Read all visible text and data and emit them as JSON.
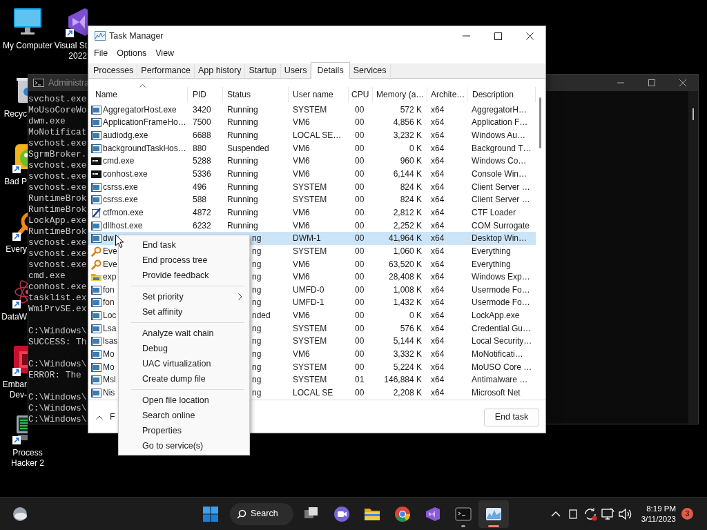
{
  "desktop": {
    "icons": [
      {
        "kind": "monitor",
        "shortcut": false,
        "lines": [
          "My Computer"
        ]
      },
      {
        "kind": "vs",
        "shortcut": true,
        "lines": [
          "Visual St",
          "2022"
        ]
      },
      {
        "kind": "bin",
        "shortcut": false,
        "lines": [
          "Recyc"
        ]
      },
      {
        "kind": "bird",
        "shortcut": true,
        "lines": [
          "Bad P"
        ]
      },
      {
        "kind": "magnifier",
        "shortcut": true,
        "lines": [
          "Every"
        ]
      },
      {
        "kind": "orbit",
        "shortcut": true,
        "lines": [
          "DataW"
        ]
      },
      {
        "kind": "embarcadero",
        "shortcut": true,
        "lines": [
          "Embar",
          "Dev-"
        ]
      },
      {
        "kind": "hacker",
        "shortcut": true,
        "lines": [
          "Process",
          "Hacker 2"
        ]
      }
    ]
  },
  "console": {
    "title": "Administra",
    "blocks": [
      [
        "svchost.exe",
        "MoUsoCoreWo",
        "dwm.exe",
        "MoNotificat",
        "svchost.exe",
        "SgrmBroker.",
        "svchost.exe",
        "svchost.exe",
        "svchost.exe",
        "RuntimeBrok",
        "RuntimeBrok",
        "LockApp.exe",
        "RuntimeBrok",
        "svchost.exe",
        "svchost.exe",
        "svchost.exe",
        "cmd.exe",
        "conhost.exe",
        "tasklist.ex",
        "WmiPrvSE.ex"
      ],
      [
        "C:\\Windows\\",
        "SUCCESS: Th"
      ],
      [
        "C:\\Windows\\",
        "ERROR: The"
      ],
      [
        "C:\\Windows\\",
        "C:\\Windows\\",
        "C:\\Windows\\"
      ]
    ]
  },
  "task_manager": {
    "title": "Task Manager",
    "menu": [
      "File",
      "Options",
      "View"
    ],
    "tabs": [
      {
        "label": "Processes",
        "selected": false
      },
      {
        "label": "Performance",
        "selected": false
      },
      {
        "label": "App history",
        "selected": false
      },
      {
        "label": "Startup",
        "selected": false
      },
      {
        "label": "Users",
        "selected": false
      },
      {
        "label": "Details",
        "selected": true
      },
      {
        "label": "Services",
        "selected": false
      }
    ],
    "columns": [
      {
        "label": "Name",
        "sorted": true
      },
      {
        "label": "PID",
        "sorted": false
      },
      {
        "label": "Status",
        "sorted": false
      },
      {
        "label": "User name",
        "sorted": false
      },
      {
        "label": "CPU",
        "sorted": false
      },
      {
        "label": "Memory (a…",
        "sorted": false
      },
      {
        "label": "Archite…",
        "sorted": false
      },
      {
        "label": "Description",
        "sorted": false
      }
    ],
    "rows": [
      {
        "kind": "app",
        "name": "AggregatorHost.exe",
        "pid": "3420",
        "status": "Running",
        "user": "SYSTEM",
        "cpu": "00",
        "memory": "572 K",
        "arch": "x64",
        "description": "AggregatorH…",
        "selected": false
      },
      {
        "kind": "app",
        "name": "ApplicationFrameHo…",
        "pid": "7500",
        "status": "Running",
        "user": "VM6",
        "cpu": "00",
        "memory": "4,856 K",
        "arch": "x64",
        "description": "Application F…",
        "selected": false
      },
      {
        "kind": "app",
        "name": "audiodg.exe",
        "pid": "6688",
        "status": "Running",
        "user": "LOCAL SE…",
        "cpu": "00",
        "memory": "3,232 K",
        "arch": "x64",
        "description": "Windows Au…",
        "selected": false
      },
      {
        "kind": "app",
        "name": "backgroundTaskHos…",
        "pid": "880",
        "status": "Suspended",
        "user": "VM6",
        "cpu": "00",
        "memory": "0 K",
        "arch": "x64",
        "description": "Background T…",
        "selected": false
      },
      {
        "kind": "console",
        "name": "cmd.exe",
        "pid": "5288",
        "status": "Running",
        "user": "VM6",
        "cpu": "00",
        "memory": "960 K",
        "arch": "x64",
        "description": "Windows Co…",
        "selected": false
      },
      {
        "kind": "console",
        "name": "conhost.exe",
        "pid": "5336",
        "status": "Running",
        "user": "VM6",
        "cpu": "00",
        "memory": "6,144 K",
        "arch": "x64",
        "description": "Console Win…",
        "selected": false
      },
      {
        "kind": "app",
        "name": "csrss.exe",
        "pid": "496",
        "status": "Running",
        "user": "SYSTEM",
        "cpu": "00",
        "memory": "824 K",
        "arch": "x64",
        "description": "Client Server …",
        "selected": false
      },
      {
        "kind": "app",
        "name": "csrss.exe",
        "pid": "588",
        "status": "Running",
        "user": "SYSTEM",
        "cpu": "00",
        "memory": "824 K",
        "arch": "x64",
        "description": "Client Server …",
        "selected": false
      },
      {
        "kind": "pen",
        "name": "ctfmon.exe",
        "pid": "4872",
        "status": "Running",
        "user": "VM6",
        "cpu": "00",
        "memory": "2,812 K",
        "arch": "x64",
        "description": "CTF Loader",
        "selected": false
      },
      {
        "kind": "app",
        "name": "dllhost.exe",
        "pid": "6232",
        "status": "Running",
        "user": "VM6",
        "cpu": "00",
        "memory": "2,252 K",
        "arch": "x64",
        "description": "COM Surrogate",
        "selected": false
      },
      {
        "kind": "app",
        "name": "dw",
        "status": "ng",
        "user": "DWM-1",
        "cpu": "00",
        "memory": "41,964 K",
        "arch": "x64",
        "description": "Desktop Win…",
        "selected": true
      },
      {
        "kind": "search",
        "name": "Eve",
        "status": "ng",
        "user": "SYSTEM",
        "cpu": "00",
        "memory": "1,060 K",
        "arch": "x64",
        "description": "Everything",
        "selected": false
      },
      {
        "kind": "search",
        "name": "Eve",
        "status": "ng",
        "user": "VM6",
        "cpu": "00",
        "memory": "63,520 K",
        "arch": "x64",
        "description": "Everything",
        "selected": false
      },
      {
        "kind": "folder",
        "name": "exp",
        "status": "ng",
        "user": "VM6",
        "cpu": "00",
        "memory": "28,408 K",
        "arch": "x64",
        "description": "Windows Exp…",
        "selected": false
      },
      {
        "kind": "app",
        "name": "fon",
        "status": "ng",
        "user": "UMFD-0",
        "cpu": "00",
        "memory": "1,008 K",
        "arch": "x64",
        "description": "Usermode Fo…",
        "selected": false
      },
      {
        "kind": "app",
        "name": "fon",
        "status": "ng",
        "user": "UMFD-1",
        "cpu": "00",
        "memory": "1,432 K",
        "arch": "x64",
        "description": "Usermode Fo…",
        "selected": false
      },
      {
        "kind": "app",
        "name": "Loc",
        "status": "nded",
        "user": "VM6",
        "cpu": "00",
        "memory": "0 K",
        "arch": "x64",
        "description": "LockApp.exe",
        "selected": false
      },
      {
        "kind": "app",
        "name": "Lsa",
        "status": "ng",
        "user": "SYSTEM",
        "cpu": "00",
        "memory": "576 K",
        "arch": "x64",
        "description": "Credential Gu…",
        "selected": false
      },
      {
        "kind": "app",
        "name": "lsas",
        "status": "ng",
        "user": "SYSTEM",
        "cpu": "00",
        "memory": "5,144 K",
        "arch": "x64",
        "description": "Local Security…",
        "selected": false
      },
      {
        "kind": "app",
        "name": "Mo",
        "status": "ng",
        "user": "VM6",
        "cpu": "00",
        "memory": "3,332 K",
        "arch": "x64",
        "description": "MoNotificati…",
        "selected": false
      },
      {
        "kind": "app",
        "name": "Mo",
        "status": "ng",
        "user": "SYSTEM",
        "cpu": "00",
        "memory": "5,224 K",
        "arch": "x64",
        "description": "MoUSO Core …",
        "selected": false
      },
      {
        "kind": "app",
        "name": "Msl",
        "status": "ng",
        "user": "SYSTEM",
        "cpu": "01",
        "memory": "146,884 K",
        "arch": "x64",
        "description": "Antimalware …",
        "selected": false
      },
      {
        "kind": "app",
        "name": "Nis",
        "status": "ng",
        "user": "LOCAL SE",
        "cpu": "00",
        "memory": "2,208 K",
        "arch": "x64",
        "description": "Microsoft Net",
        "selected": false
      }
    ],
    "fewer_details": "F",
    "end_task_button": "End task"
  },
  "context_menu": {
    "groups": [
      [
        {
          "label": "End task",
          "submenu": false
        },
        {
          "label": "End process tree",
          "submenu": false
        },
        {
          "label": "Provide feedback",
          "submenu": false
        }
      ],
      [
        {
          "label": "Set priority",
          "submenu": true
        },
        {
          "label": "Set affinity",
          "submenu": false
        }
      ],
      [
        {
          "label": "Analyze wait chain",
          "submenu": false
        },
        {
          "label": "Debug",
          "submenu": false
        },
        {
          "label": "UAC virtualization",
          "submenu": false
        },
        {
          "label": "Create dump file",
          "submenu": false
        }
      ],
      [
        {
          "label": "Open file location",
          "submenu": false
        },
        {
          "label": "Search online",
          "submenu": false
        },
        {
          "label": "Properties",
          "submenu": false
        },
        {
          "label": "Go to service(s)",
          "submenu": false
        }
      ]
    ]
  },
  "taskbar": {
    "search_label": "Search",
    "apps": [
      {
        "kind": "taskview",
        "running": false,
        "active": false
      },
      {
        "kind": "chat",
        "running": false,
        "active": false
      },
      {
        "kind": "explorer",
        "running": false,
        "active": false
      },
      {
        "kind": "browser",
        "running": false,
        "active": false
      },
      {
        "kind": "vs",
        "running": false,
        "active": false
      },
      {
        "kind": "terminal",
        "running": true,
        "active": false
      },
      {
        "kind": "taskmgr",
        "running": true,
        "active": true
      }
    ],
    "time": "8:19 PM",
    "date": "3/11/2023",
    "notification_count": "3"
  }
}
